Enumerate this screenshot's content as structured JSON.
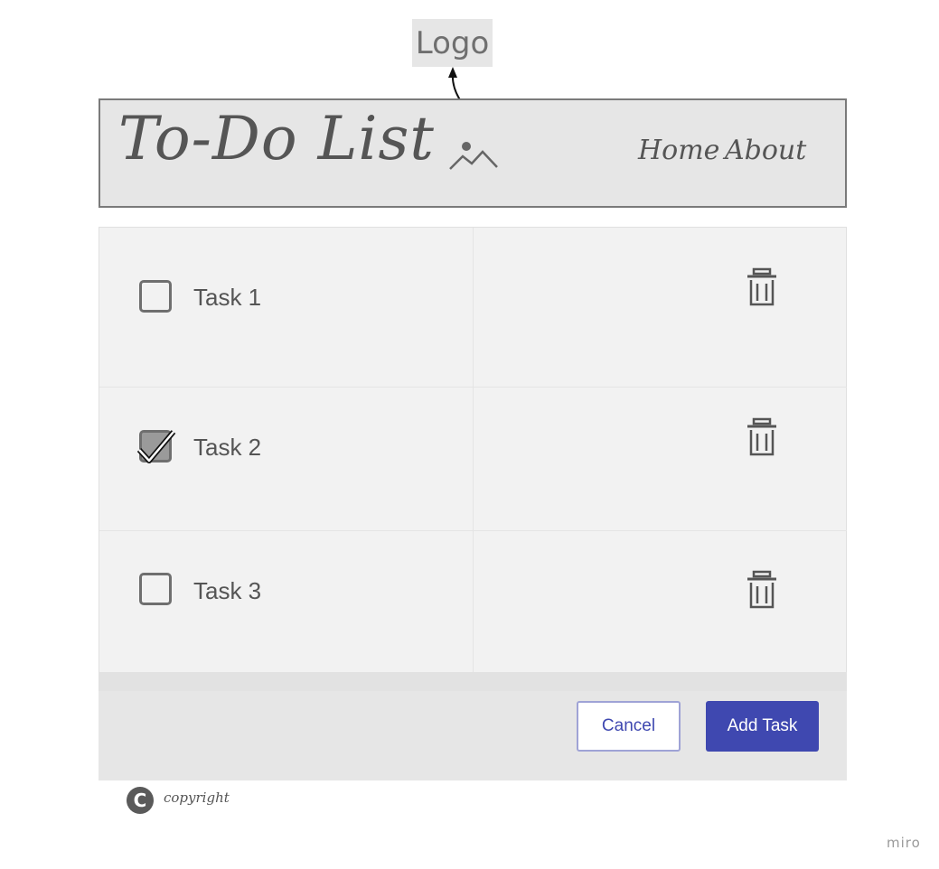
{
  "annotation": {
    "logo_label": "Logo"
  },
  "header": {
    "title": "To-Do List",
    "image_icon": "image-placeholder-icon",
    "nav": {
      "home": "Home",
      "about": "About"
    }
  },
  "tasks": [
    {
      "label": "Task 1",
      "checked": false,
      "delete_icon": "trash-icon"
    },
    {
      "label": "Task 2",
      "checked": true,
      "delete_icon": "trash-icon"
    },
    {
      "label": "Task 3",
      "checked": false,
      "delete_icon": "trash-icon"
    }
  ],
  "actions": {
    "cancel_label": "Cancel",
    "add_label": "Add Task"
  },
  "footer": {
    "copyright_symbol": "C",
    "copyright_text": "copyright"
  },
  "watermark": "miro",
  "colors": {
    "primary": "#3f48b0",
    "panel": "#e6e6e6",
    "grid": "#f2f2f2",
    "text": "#555555"
  }
}
